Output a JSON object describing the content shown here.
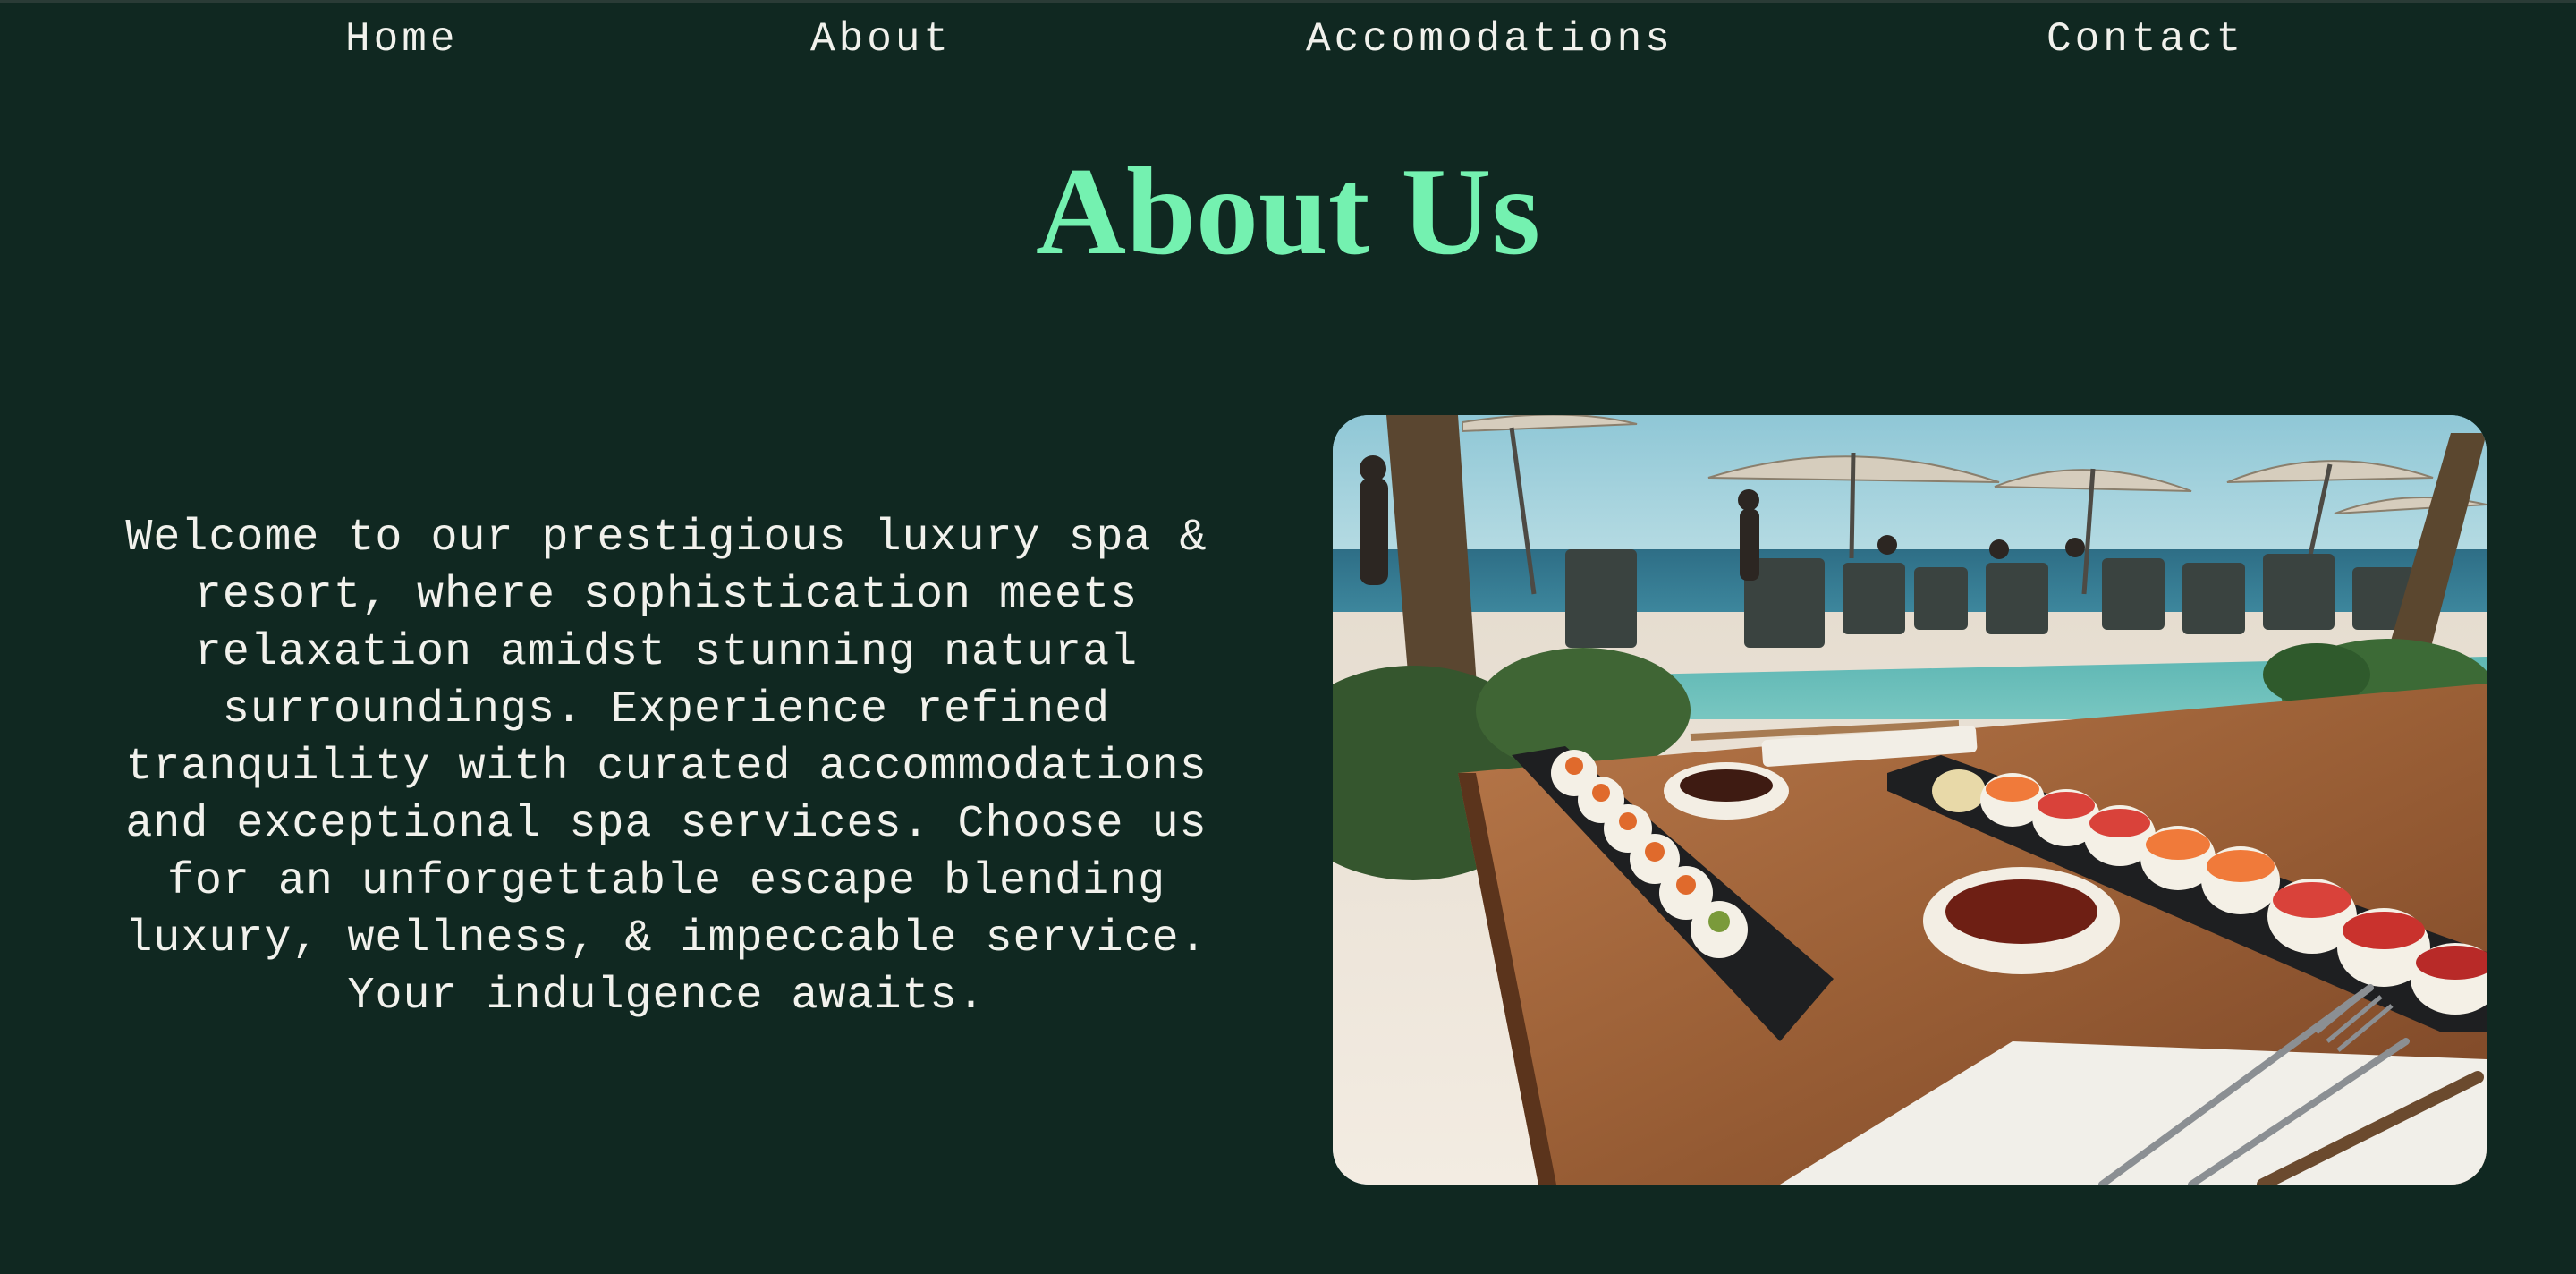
{
  "nav": {
    "items": [
      {
        "label": "Home"
      },
      {
        "label": "About"
      },
      {
        "label": "Accomodations"
      },
      {
        "label": "Contact"
      }
    ]
  },
  "page": {
    "title": "About Us",
    "intro": "Welcome to our prestigious luxury spa & resort, where sophistication meets relaxation amidst stunning natural surroundings. Experience refined tranquility with curated accommodations and exceptional spa services. Choose us for an unforgettable escape blending luxury, wellness, & impeccable service. Your indulgence awaits."
  },
  "colors": {
    "background": "#102821",
    "accent": "#74f1b0",
    "text": "#f1f1ec"
  },
  "image": {
    "subject": "Sushi platters on a wooden table beside a resort pool with umbrellas and lounge chairs"
  }
}
